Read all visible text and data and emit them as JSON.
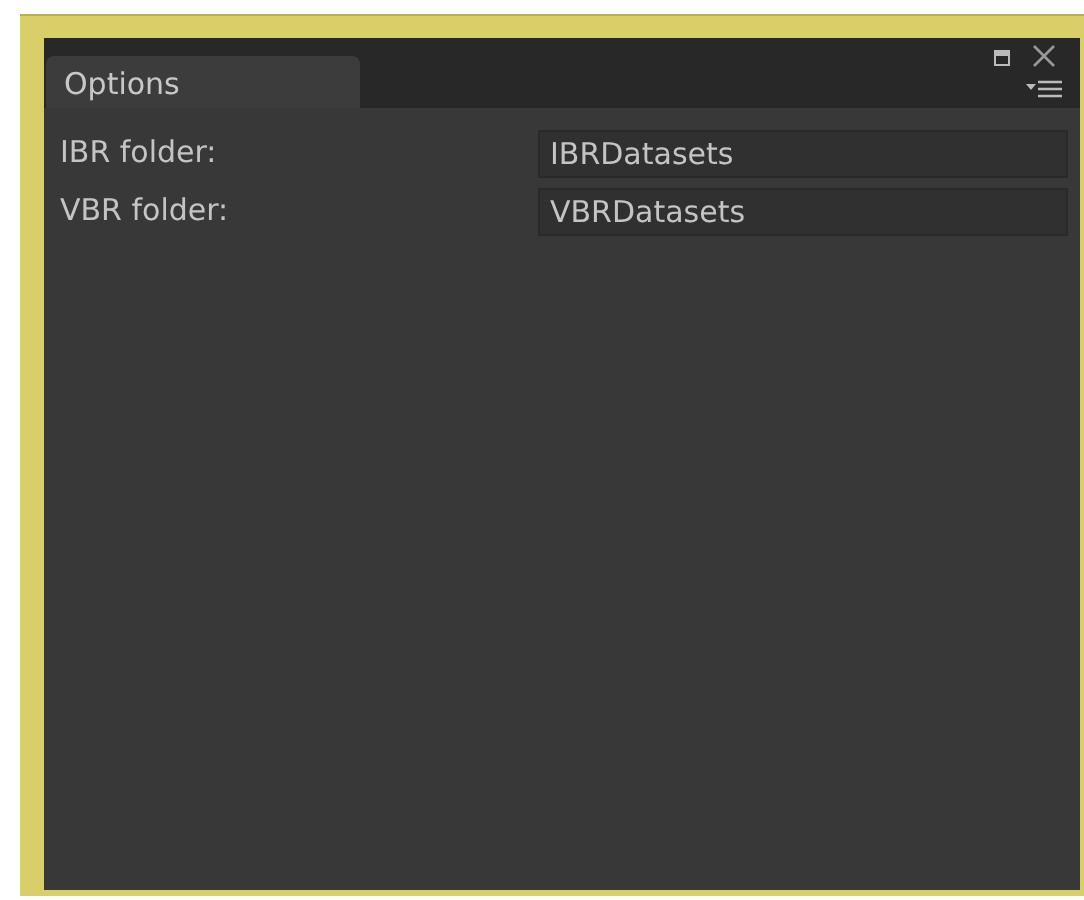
{
  "tabs": [
    {
      "label": "Options",
      "selected": true
    }
  ],
  "fields": [
    {
      "label": "IBR folder:",
      "value": "IBRDatasets"
    },
    {
      "label": "VBR folder:",
      "value": "VBRDatasets"
    }
  ]
}
